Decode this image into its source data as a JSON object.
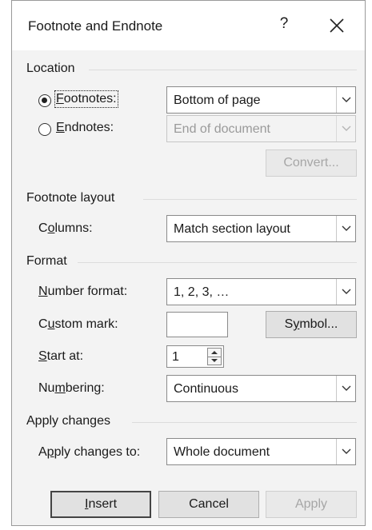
{
  "dialog": {
    "title": "Footnote and Endnote",
    "help_glyph": "?",
    "close_icon": "close-icon"
  },
  "location": {
    "heading": "Location",
    "footnotes": {
      "label_pre": "",
      "label_mnemonic": "F",
      "label_post": "ootnotes:",
      "selected": true,
      "value": "Bottom of page"
    },
    "endnotes": {
      "label_mnemonic": "E",
      "label_post": "ndnotes:",
      "selected": false,
      "value": "End of document"
    },
    "convert_label": "Convert..."
  },
  "footnote_layout": {
    "heading": "Footnote layout",
    "columns_pre": "C",
    "columns_mnemonic": "o",
    "columns_post": "lumns:",
    "columns_value": "Match section layout"
  },
  "format": {
    "heading": "Format",
    "number_format_mnemonic": "N",
    "number_format_post": "umber format:",
    "number_format_value": "1, 2, 3, …",
    "custom_mark_pre": "C",
    "custom_mark_mnemonic": "u",
    "custom_mark_post": "stom mark:",
    "custom_mark_value": "",
    "symbol_pre": "S",
    "symbol_mnemonic": "y",
    "symbol_post": "mbol...",
    "start_at_mnemonic": "S",
    "start_at_post": "tart at:",
    "start_at_value": "1",
    "numbering_pre": "Nu",
    "numbering_mnemonic": "m",
    "numbering_post": "bering:",
    "numbering_value": "Continuous"
  },
  "apply_changes": {
    "heading": "Apply changes",
    "apply_to_pre": "A",
    "apply_to_mnemonic": "p",
    "apply_to_post": "ply changes to:",
    "apply_to_value": "Whole document"
  },
  "buttons": {
    "insert_mnemonic": "I",
    "insert_post": "nsert",
    "cancel": "Cancel",
    "apply": "Apply"
  },
  "colors": {
    "dialog_bg": "#f3f3f3",
    "disabled_text": "#9a9a9a"
  }
}
